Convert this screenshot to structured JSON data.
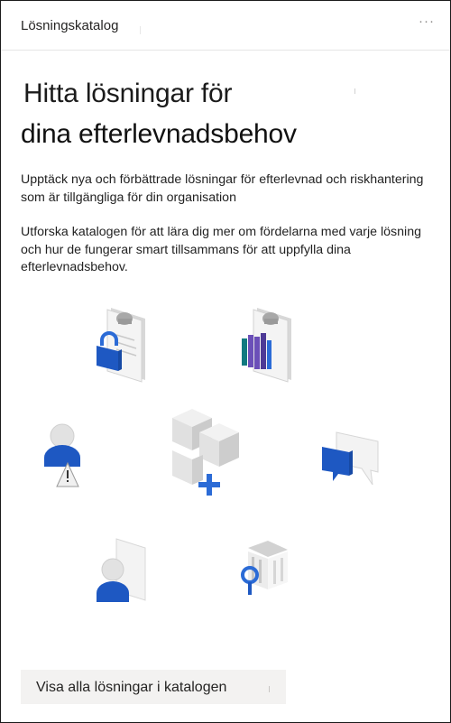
{
  "header": {
    "title": "Lösningskatalog",
    "more_label": "···"
  },
  "hero": {
    "title_line1": "Hitta lösningar för",
    "title_line2": "dina efterlevnadsbehov"
  },
  "body": {
    "paragraph1": "Upptäck nya och förbättrade lösningar för efterlevnad och riskhantering som är tillgängliga för din organisation",
    "paragraph2": "Utforska katalogen för att lära dig mer om fördelarna med varje lösning och hur de fungerar smart tillsammans för att uppfylla dina efterlevnadsbehov."
  },
  "illustration": {
    "icons": [
      "clipboard-lock-icon",
      "clipboard-books-icon",
      "user-warning-icon",
      "cubes-plus-icon",
      "chat-bubbles-icon",
      "user-document-icon",
      "bank-search-icon"
    ],
    "colors": {
      "blue": "#2b6bd6",
      "purple": "#6b4fb8",
      "teal": "#117a80",
      "grey": "#e6e6e6"
    }
  },
  "cta": {
    "label": "Visa alla lösningar i katalogen"
  }
}
